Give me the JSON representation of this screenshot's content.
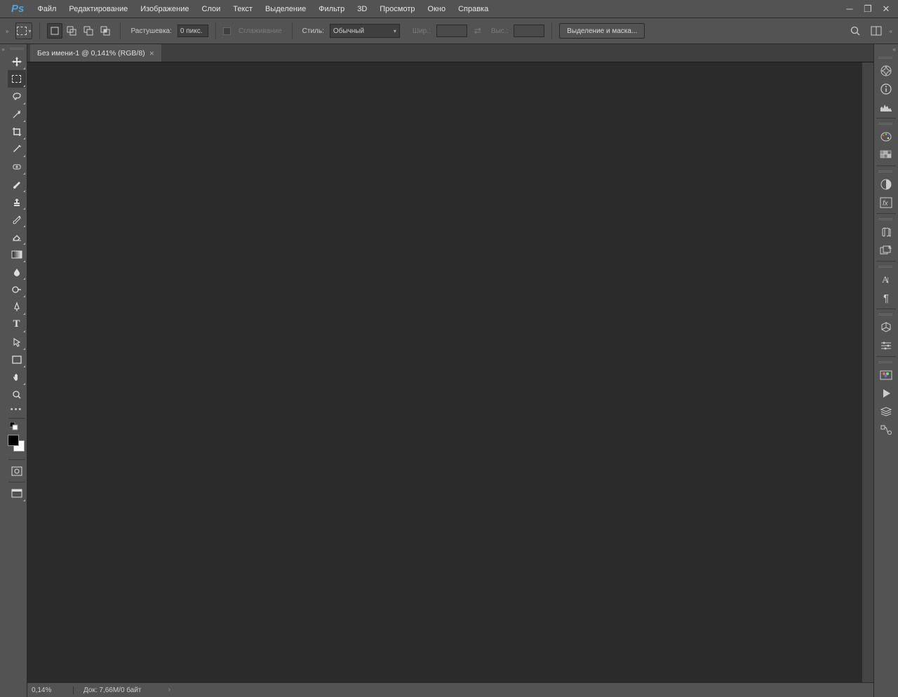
{
  "app": {
    "logo": "Ps"
  },
  "menu": [
    "Файл",
    "Редактирование",
    "Изображение",
    "Слои",
    "Текст",
    "Выделение",
    "Фильтр",
    "3D",
    "Просмотр",
    "Окно",
    "Справка"
  ],
  "options": {
    "feather_label": "Растушевка:",
    "feather_value": "0 пикс.",
    "antialias_label": "Сглаживание",
    "style_label": "Стиль:",
    "style_value": "Обычный",
    "width_label": "Шир.:",
    "height_label": "Выс.:",
    "select_mask_btn": "Выделение и маска..."
  },
  "tab": {
    "title": "Без имени-1 @ 0,141% (RGB/8)"
  },
  "status": {
    "zoom": "0,14%",
    "doc": "Док: 7,66M/0 байт"
  },
  "tools": [
    {
      "name": "move-tool",
      "tri": true
    },
    {
      "name": "marquee-tool",
      "active": true,
      "tri": true
    },
    {
      "name": "lasso-tool",
      "tri": true
    },
    {
      "name": "magic-wand-tool",
      "tri": true
    },
    {
      "name": "crop-tool",
      "tri": true
    },
    {
      "name": "eyedropper-tool",
      "tri": true
    },
    {
      "name": "healing-brush-tool",
      "tri": true
    },
    {
      "name": "brush-tool",
      "tri": true
    },
    {
      "name": "clone-stamp-tool",
      "tri": true
    },
    {
      "name": "history-brush-tool",
      "tri": true
    },
    {
      "name": "eraser-tool",
      "tri": true
    },
    {
      "name": "gradient-tool",
      "tri": true
    },
    {
      "name": "blur-tool",
      "tri": true
    },
    {
      "name": "dodge-tool",
      "tri": true
    },
    {
      "name": "pen-tool",
      "tri": true
    },
    {
      "name": "type-tool",
      "tri": true
    },
    {
      "name": "path-select-tool",
      "tri": true
    },
    {
      "name": "rectangle-tool",
      "tri": true
    },
    {
      "name": "hand-tool",
      "tri": true
    },
    {
      "name": "zoom-tool"
    }
  ],
  "panels": [
    [
      "navigator-panel",
      "info-panel",
      "histogram-panel"
    ],
    [
      "color-panel",
      "swatches-panel"
    ],
    [
      "adjustments-panel",
      "styles-panel"
    ],
    [
      "libraries-panel",
      "layer-comps-panel"
    ],
    [
      "character-panel",
      "paragraph-panel"
    ],
    [
      "3d-panel",
      "properties-panel"
    ],
    [
      "channels-panel",
      "actions-panel",
      "layers-panel",
      "paths-panel"
    ]
  ]
}
